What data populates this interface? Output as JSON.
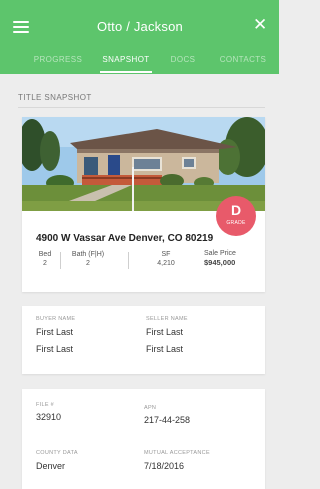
{
  "header": {
    "title": "Otto / Jackson"
  },
  "tabs": [
    {
      "label": "PROGRESS"
    },
    {
      "label": "SNAPSHOT"
    },
    {
      "label": "DOCS"
    },
    {
      "label": "CONTACTS"
    }
  ],
  "section": {
    "title": "TITLE SNAPSHOT"
  },
  "property": {
    "grade": "D",
    "grade_label": "GRADE",
    "address": "4900 W Vassar Ave Denver, CO 80219",
    "bed_label": "Bed",
    "bed": "2",
    "bath_label": "Bath (F|H)",
    "bath": "2",
    "sf_label": "SF",
    "sf": "4,210",
    "price_label": "Sale Price",
    "price": "$945,000"
  },
  "parties": {
    "buyer_label": "BUYER NAME",
    "buyer_1": "First Last",
    "buyer_2": "First Last",
    "seller_label": "SELLER NAME",
    "seller_1": "First Last",
    "seller_2": "First Last"
  },
  "file": {
    "file_label": "FILE #",
    "file_no": "32910",
    "apn_label": "APN",
    "apn": "217-44-258",
    "county_label": "COUNTY DATA",
    "county": "Denver",
    "mutual_label": "MUTUAL ACCEPTANCE",
    "mutual": "7/18/2016"
  },
  "colors": {
    "header_green": "#5dc56c",
    "grade_red": "#e85a6a"
  }
}
